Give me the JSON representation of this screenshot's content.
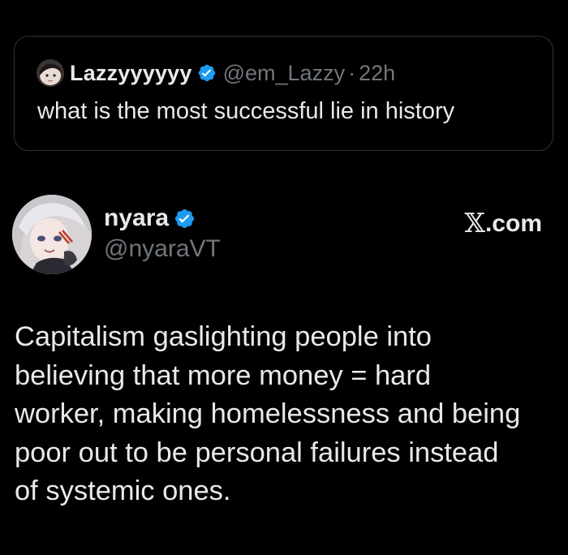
{
  "quoted_tweet": {
    "author_name": "Lazzyyyyyy",
    "handle": "@em_Lazzy",
    "separator": "·",
    "time": "22h",
    "verified": true,
    "text": "what is the most successful lie in history"
  },
  "tweet": {
    "author_name": "nyara",
    "handle": "@nyaraVT",
    "verified": true,
    "site_label": {
      "glyph": "𝕏",
      "suffix": ".com"
    },
    "body_lines": [
      "Capitalism gaslighting people into",
      "believing that more money = hard",
      "worker, making homelessness and being",
      "poor out to be personal failures instead",
      "of systemic ones."
    ]
  },
  "colors": {
    "background": "#000000",
    "text_primary": "#e7e9ea",
    "text_secondary": "#71767b",
    "card_border": "#2f3336",
    "verified_badge": "#1d9bf0"
  },
  "icons": {
    "verified": "verified-badge-icon",
    "avatar_quote": "avatar-lazzy",
    "avatar_author": "avatar-nyara"
  }
}
